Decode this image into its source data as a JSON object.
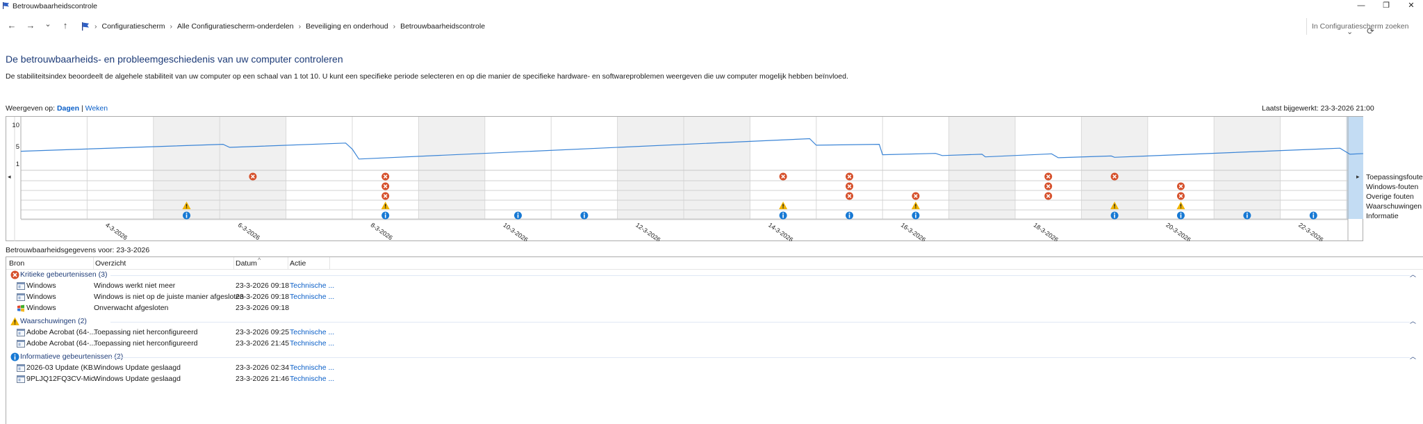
{
  "window": {
    "title": "Betrouwbaarheidscontrole",
    "minimize": "—",
    "maximize": "❐",
    "close": "✕"
  },
  "address": {
    "nav_back": "←",
    "nav_forward": "→",
    "nav_recent": "⌄",
    "nav_up": "↑",
    "breadcrumbs": [
      "Configuratiescherm",
      "Alle Configuratiescherm-onderdelen",
      "Beveiliging en onderhoud",
      "Betrouwbaarheidscontrole"
    ],
    "separator": "›",
    "dropdown": "⌄",
    "refresh": "⟳",
    "search_placeholder": "In Configuratiescherm zoeken"
  },
  "page": {
    "heading": "De betrouwbaarheids- en probleemgeschiedenis van uw computer controleren",
    "description": "De stabiliteitsindex beoordeelt de algehele stabiliteit van uw computer op een schaal van 1 tot 10. U kunt een specifieke periode selecteren en op die manier de specifieke hardware- en softwareproblemen weergeven die uw computer mogelijk hebben beïnvloed.",
    "view_label": "Weergeven op:",
    "view_days": "Dagen",
    "view_separator": "|",
    "view_weeks": "Weken",
    "last_updated": "Laatst bijgewerkt: 23-3-2026 21:00"
  },
  "chart_data": {
    "type": "line",
    "title": "",
    "ylabel": "",
    "yticks": [
      "10",
      "5",
      "1"
    ],
    "ylim": [
      1,
      10
    ],
    "days": [
      "3-3-2026",
      "4-3-2026",
      "5-3-2026",
      "6-3-2026",
      "7-3-2026",
      "8-3-2026",
      "9-3-2026",
      "10-3-2026",
      "11-3-2026",
      "12-3-2026",
      "13-3-2026",
      "14-3-2026",
      "15-3-2026",
      "16-3-2026",
      "17-3-2026",
      "18-3-2026",
      "19-3-2026",
      "20-3-2026",
      "21-3-2026",
      "22-3-2026",
      "23-3-2026"
    ],
    "x_tick_labels": [
      {
        "day": 1,
        "label": "4-3-2026"
      },
      {
        "day": 3,
        "label": "6-3-2026"
      },
      {
        "day": 5,
        "label": "8-3-2026"
      },
      {
        "day": 7,
        "label": "10-3-2026"
      },
      {
        "day": 9,
        "label": "12-3-2026"
      },
      {
        "day": 11,
        "label": "14-3-2026"
      },
      {
        "day": 13,
        "label": "16-3-2026"
      },
      {
        "day": 15,
        "label": "18-3-2026"
      },
      {
        "day": 17,
        "label": "20-3-2026"
      },
      {
        "day": 19,
        "label": "22-3-2026"
      }
    ],
    "shaded_days": [
      2,
      3,
      6,
      9,
      10,
      14,
      16,
      18
    ],
    "selected_day": 20,
    "stability_index": [
      {
        "x": 0,
        "y": 3.8
      },
      {
        "x": 3.05,
        "y": 5.4
      },
      {
        "x": 3.15,
        "y": 4.7
      },
      {
        "x": 4.9,
        "y": 5.7
      },
      {
        "x": 5.0,
        "y": 4.3
      },
      {
        "x": 5.1,
        "y": 2.0
      },
      {
        "x": 11.9,
        "y": 6.7
      },
      {
        "x": 12.0,
        "y": 5.2
      },
      {
        "x": 12.95,
        "y": 5.4
      },
      {
        "x": 13.0,
        "y": 3.0
      },
      {
        "x": 13.8,
        "y": 3.3
      },
      {
        "x": 13.9,
        "y": 2.8
      },
      {
        "x": 14.5,
        "y": 3.1
      },
      {
        "x": 14.55,
        "y": 2.5
      },
      {
        "x": 15.55,
        "y": 3.2
      },
      {
        "x": 15.65,
        "y": 2.3
      },
      {
        "x": 16.45,
        "y": 2.7
      },
      {
        "x": 16.5,
        "y": 2.4
      },
      {
        "x": 19.9,
        "y": 4.5
      },
      {
        "x": 20.05,
        "y": 3.1
      },
      {
        "x": 20.7,
        "y": 3.6
      }
    ],
    "event_rows": [
      "Toepassingsfouten",
      "Windows-fouten",
      "Overige fouten",
      "Waarschuwingen",
      "Informatie"
    ],
    "events": [
      {
        "row": 0,
        "days": [
          3,
          5,
          11,
          12,
          15,
          16
        ]
      },
      {
        "row": 1,
        "days": [
          5,
          12,
          15,
          17,
          20
        ]
      },
      {
        "row": 2,
        "days": [
          5,
          12,
          13,
          15,
          17,
          20
        ]
      },
      {
        "row": 3,
        "days": [
          2,
          5,
          11,
          13,
          16,
          17,
          20
        ]
      },
      {
        "row": 4,
        "days": [
          2,
          5,
          7,
          8,
          11,
          12,
          13,
          16,
          17,
          18,
          19,
          20
        ]
      }
    ],
    "scroll_left": "◂",
    "scroll_right": "▸"
  },
  "colors": {
    "error": "#d6502b",
    "warning": "#f0b400",
    "info": "#1779d4",
    "line": "#3a84d6",
    "selection": "#c3dcf3",
    "shade": "#f0f0f0"
  },
  "details": {
    "title": "Betrouwbaarheidsgegevens voor: 23-3-2026",
    "columns": [
      "Bron",
      "Overzicht",
      "Datum",
      "Actie"
    ],
    "sort_indicator": "^",
    "collapse_glyph": "︿",
    "groups": [
      {
        "label": "Kritieke gebeurtenissen (3)",
        "icon": "error-icon",
        "rows": [
          {
            "source": "Windows",
            "summary": "Windows werkt niet meer",
            "date": "23-3-2026 09:18",
            "action": "Technische ...",
            "icon": "app-window-icon"
          },
          {
            "source": "Windows",
            "summary": "Windows is niet op de juiste manier afgesloten",
            "date": "23-3-2026 09:18",
            "action": "Technische ...",
            "icon": "app-window-icon"
          },
          {
            "source": "Windows",
            "summary": "Onverwacht afgesloten",
            "date": "23-3-2026 09:18",
            "action": "",
            "icon": "windows-flag-icon"
          }
        ]
      },
      {
        "label": "Waarschuwingen (2)",
        "icon": "warning-icon",
        "rows": [
          {
            "source": "Adobe Acrobat (64-...",
            "summary": "Toepassing niet herconfigureerd",
            "date": "23-3-2026 09:25",
            "action": "Technische ...",
            "icon": "app-window-icon"
          },
          {
            "source": "Adobe Acrobat (64-...",
            "summary": "Toepassing niet herconfigureerd",
            "date": "23-3-2026 21:45",
            "action": "Technische ...",
            "icon": "app-window-icon"
          }
        ]
      },
      {
        "label": "Informatieve gebeurtenissen (2)",
        "icon": "info-icon",
        "rows": [
          {
            "source": "2026-03 Update (KB...",
            "summary": "Windows Update geslaagd",
            "date": "23-3-2026 02:34",
            "action": "Technische ...",
            "icon": "app-window-icon"
          },
          {
            "source": "9PLJQ12FQ3CV-Mic...",
            "summary": "Windows Update geslaagd",
            "date": "23-3-2026 21:46",
            "action": "Technische ...",
            "icon": "app-window-icon"
          }
        ]
      }
    ]
  }
}
